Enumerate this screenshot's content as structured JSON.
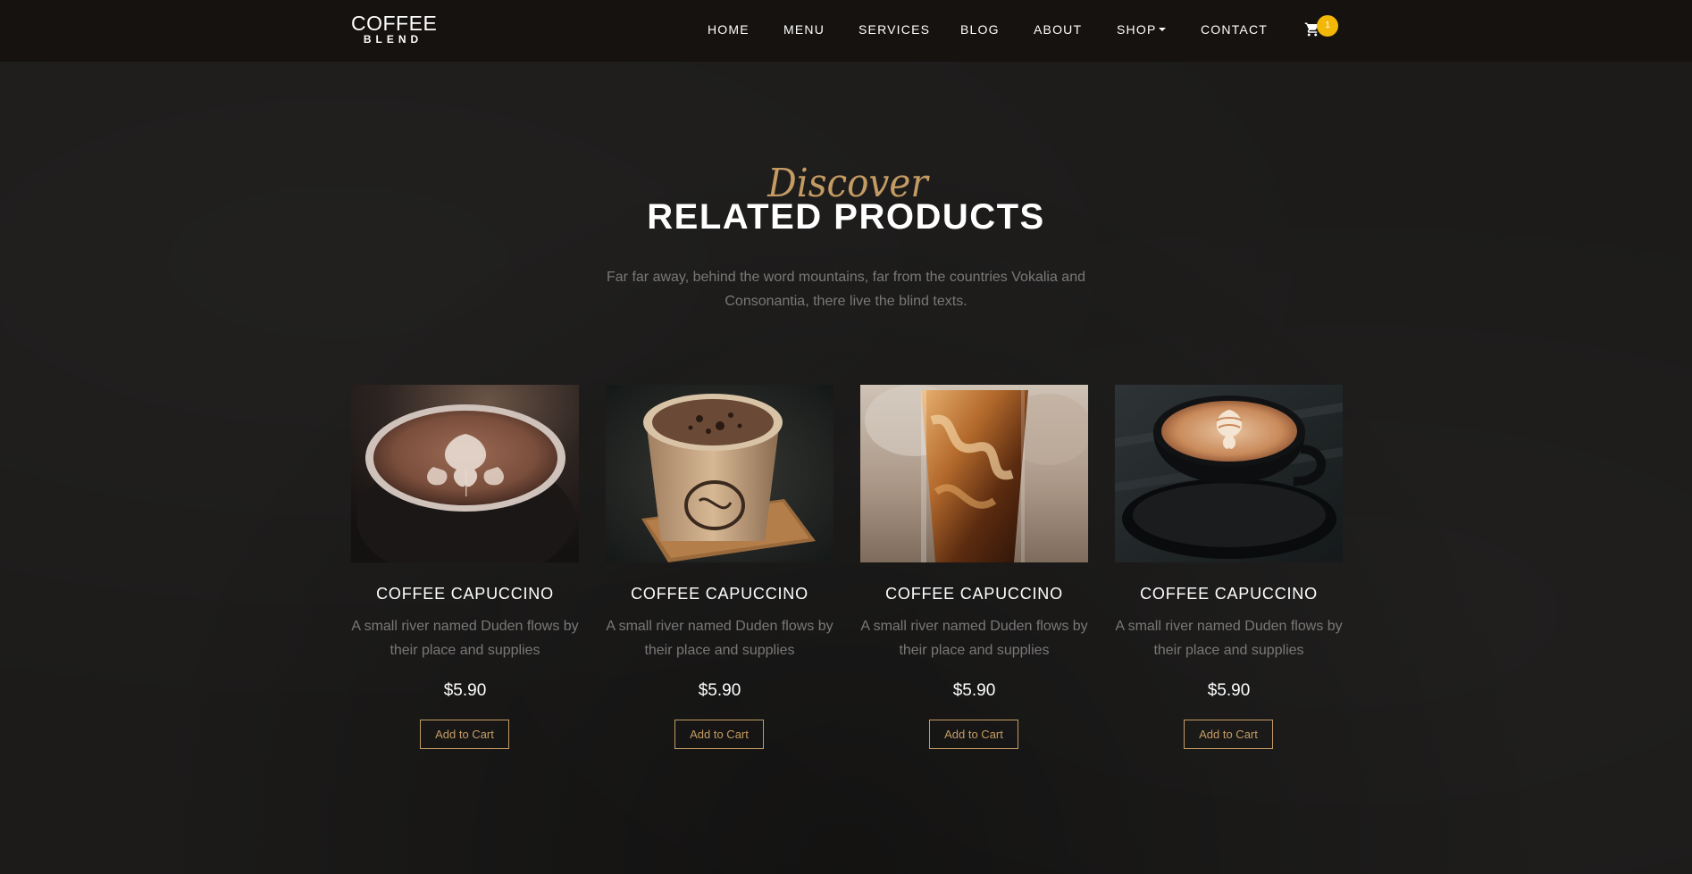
{
  "brand": {
    "line1": "COFFEE",
    "line2": "BLEND"
  },
  "nav": {
    "items": [
      {
        "label": "HOME"
      },
      {
        "label": "MENU"
      },
      {
        "label": "SERVICES"
      },
      {
        "label": "BLOG"
      },
      {
        "label": "ABOUT"
      },
      {
        "label": "SHOP",
        "has_dropdown": true
      },
      {
        "label": "CONTACT"
      }
    ],
    "cart": {
      "icon": "cart-icon",
      "count": "1"
    }
  },
  "section": {
    "subheading": "Discover",
    "title": "RELATED PRODUCTS",
    "intro": "Far far away, behind the word mountains, far from the countries Vokalia and Consonantia, there live the blind texts."
  },
  "products": [
    {
      "name": "COFFEE CAPUCCINO",
      "description": "A small river named Duden flows by their place and supplies",
      "price": "$5.90",
      "button": "Add to Cart",
      "image": "latte-art-cup-photo"
    },
    {
      "name": "COFFEE CAPUCCINO",
      "description": "A small river named Duden flows by their place and supplies",
      "price": "$5.90",
      "button": "Add to Cart",
      "image": "paper-cup-coffee-photo"
    },
    {
      "name": "COFFEE CAPUCCINO",
      "description": "A small river named Duden flows by their place and supplies",
      "price": "$5.90",
      "button": "Add to Cart",
      "image": "iced-coffee-glass-photo"
    },
    {
      "name": "COFFEE CAPUCCINO",
      "description": "A small river named Duden flows by their place and supplies",
      "price": "$5.90",
      "button": "Add to Cart",
      "image": "black-cup-latte-photo"
    }
  ],
  "colors": {
    "accent": "#c49b63",
    "badge": "#f2b707",
    "navbar": "#151210",
    "background": "#1c1b1a",
    "muted_text": "#7a7877"
  }
}
